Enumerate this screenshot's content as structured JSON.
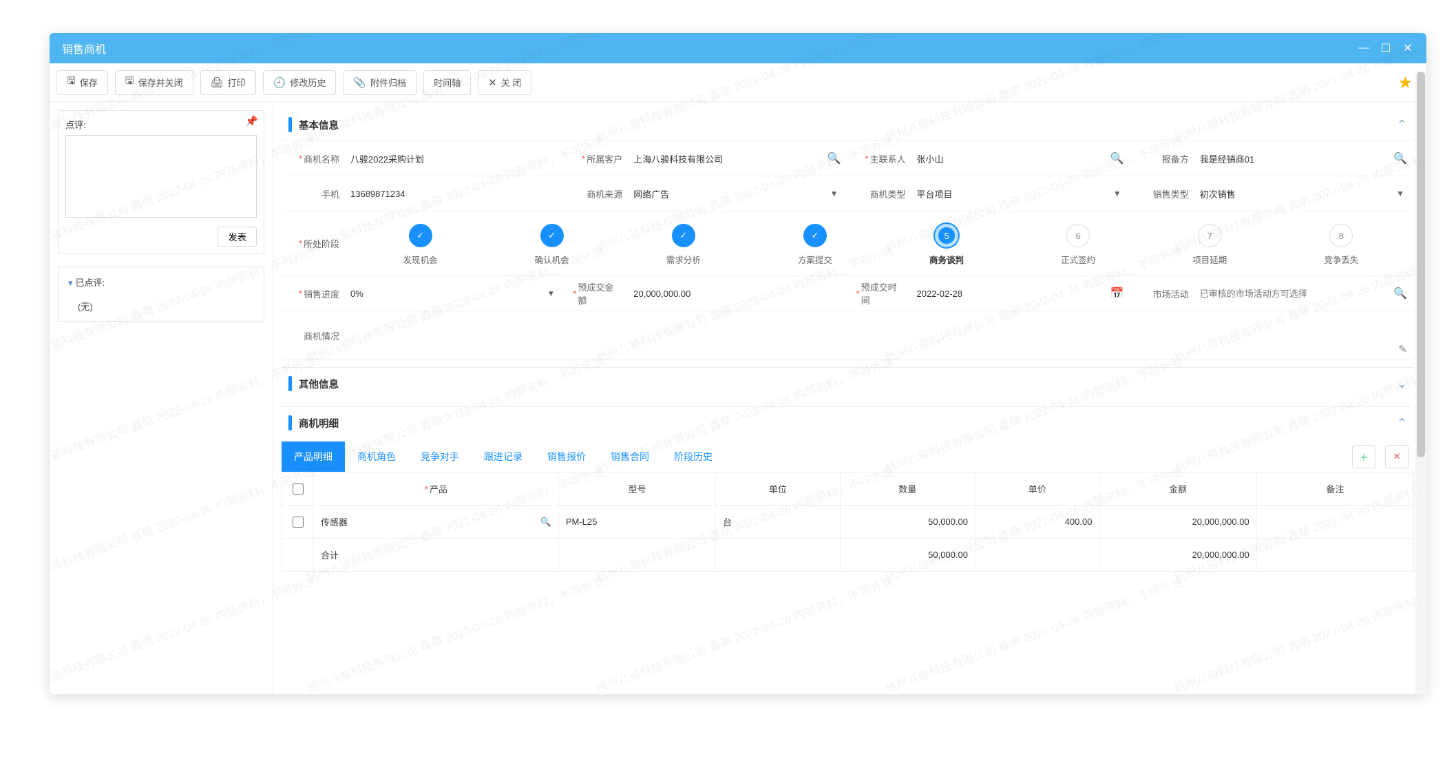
{
  "modal": {
    "title": "销售商机"
  },
  "toolbar": {
    "save": "保存",
    "save_close": "保存并关闭",
    "print": "打印",
    "history": "修改历史",
    "attachment": "附件归档",
    "timeline": "时间轴",
    "close": "关 闭"
  },
  "sidebar": {
    "comment_label": "点评:",
    "post": "发表",
    "reviewed_label": "已点评:",
    "none": "(无)"
  },
  "sections": {
    "basic": "基本信息",
    "other": "其他信息",
    "detail": "商机明细"
  },
  "fields": {
    "opp_name": {
      "label": "商机名称",
      "value": "八骏2022采购计划"
    },
    "customer": {
      "label": "所属客户",
      "value": "上海八骏科技有限公司"
    },
    "contact": {
      "label": "主联系人",
      "value": "张小山"
    },
    "filer": {
      "label": "报备方",
      "value": "我是经销商01"
    },
    "phone": {
      "label": "手机",
      "value": "13689871234"
    },
    "source": {
      "label": "商机来源",
      "value": "网络广告"
    },
    "type": {
      "label": "商机类型",
      "value": "平台项目"
    },
    "sale_type": {
      "label": "销售类型",
      "value": "初次销售"
    },
    "stage_label": "所处阶段",
    "progress": {
      "label": "销售进度",
      "value": "0%"
    },
    "est_amount": {
      "label": "预成交金额",
      "value": "20,000,000.00"
    },
    "est_date": {
      "label": "预成交时间",
      "value": "2022-02-28"
    },
    "campaign": {
      "label": "市场活动",
      "placeholder": "已审核的市场活动方可选择"
    },
    "situation": {
      "label": "商机情况"
    }
  },
  "stages": [
    {
      "label": "发现机会",
      "state": "done",
      "mark": "✓"
    },
    {
      "label": "确认机会",
      "state": "done",
      "mark": "✓"
    },
    {
      "label": "需求分析",
      "state": "done",
      "mark": "✓"
    },
    {
      "label": "方案提交",
      "state": "done",
      "mark": "✓"
    },
    {
      "label": "商务谈判",
      "state": "curr",
      "mark": "5"
    },
    {
      "label": "正式签约",
      "state": "todo",
      "mark": "6"
    },
    {
      "label": "项目延期",
      "state": "todo",
      "mark": "7"
    },
    {
      "label": "竞争丢失",
      "state": "todo",
      "mark": "8"
    }
  ],
  "detail_tabs": [
    "产品明细",
    "商机角色",
    "竞争对手",
    "跟进记录",
    "销售报价",
    "销售合同",
    "阶段历史"
  ],
  "table": {
    "headers": {
      "product": "产品",
      "model": "型号",
      "unit": "单位",
      "qty": "数量",
      "price": "单价",
      "amount": "金额",
      "note": "备注"
    },
    "row": {
      "product": "传感器",
      "model": "PM-L25",
      "unit": "台",
      "qty": "50,000.00",
      "price": "400.00",
      "amount": "20,000,000.00",
      "note": ""
    },
    "total": {
      "label": "合计",
      "qty": "50,000.00",
      "amount": "20,000,000.00"
    }
  },
  "watermark": "杭州八骏科技有限公司 鑫萌 2022-04-26 内部资料，不可外泄"
}
